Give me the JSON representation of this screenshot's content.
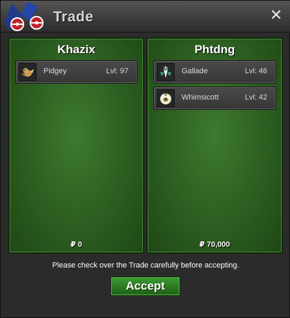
{
  "window": {
    "title": "Trade",
    "close_label": "✕"
  },
  "left_panel": {
    "player": "Khazix",
    "pokemon": [
      {
        "name": "Pidgey",
        "level": "Lvl: 97",
        "icon": "pidgey-icon"
      }
    ],
    "money": "₽ 0"
  },
  "right_panel": {
    "player": "Phtdng",
    "pokemon": [
      {
        "name": "Gallade",
        "level": "Lvl: 46",
        "icon": "gallade-icon"
      },
      {
        "name": "Whimsicott",
        "level": "Lvl: 42",
        "icon": "whimsicott-icon"
      }
    ],
    "money": "₽ 70,000"
  },
  "footer": {
    "notice": "Please check over the Trade carefully before accepting.",
    "accept_label": "Accept"
  },
  "colors": {
    "panel_green": "#2f6323",
    "button_green": "#2a7a22",
    "titlebar": "#3d3d3d"
  }
}
